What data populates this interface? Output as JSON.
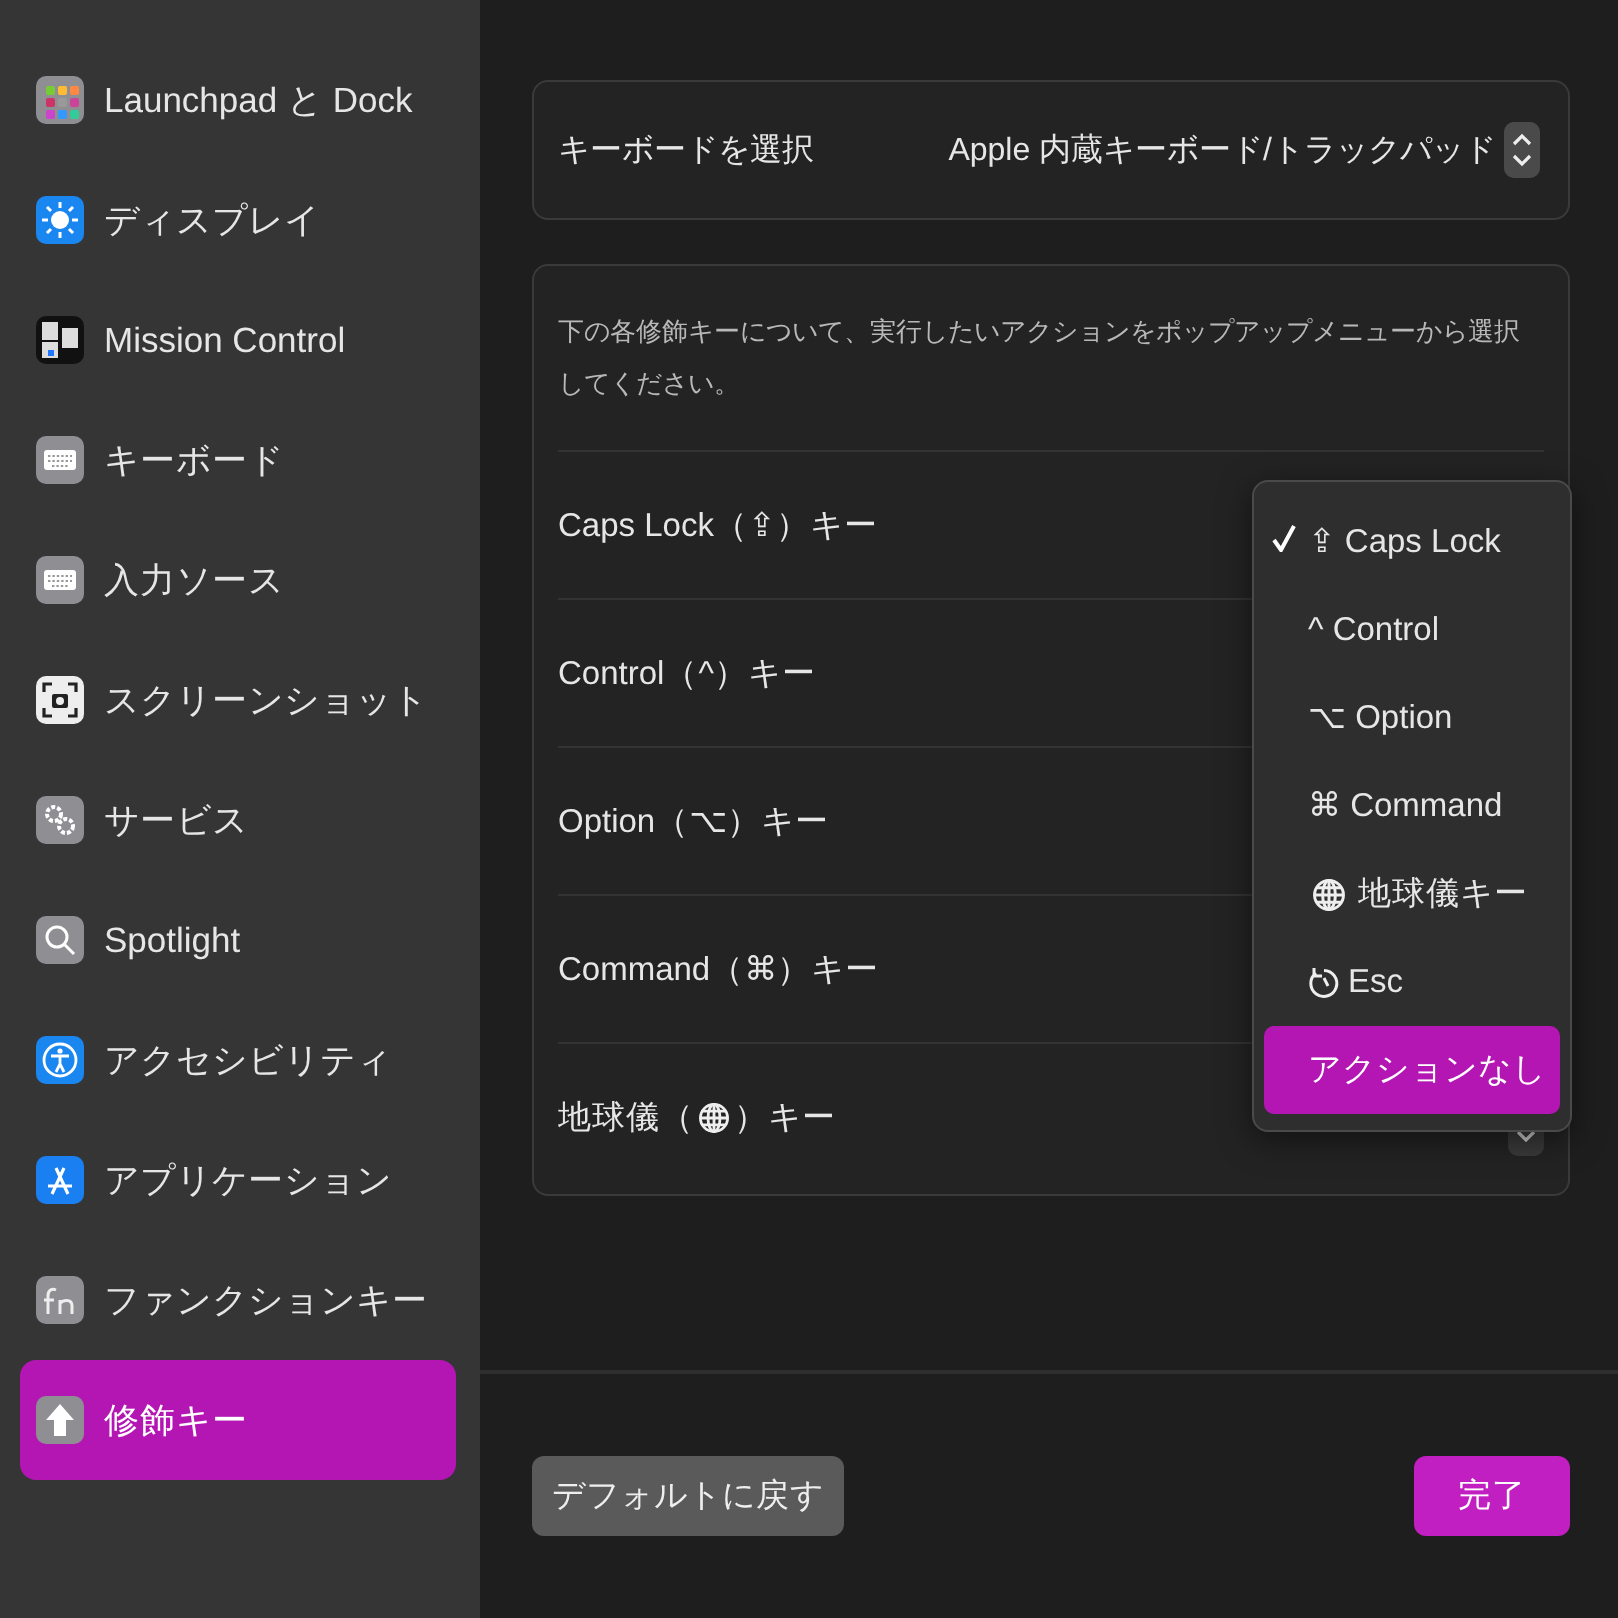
{
  "sidebar": {
    "items": [
      {
        "label": "Launchpad と Dock",
        "kind": "launchpad",
        "selected": false
      },
      {
        "label": "ディスプレイ",
        "kind": "display",
        "selected": false
      },
      {
        "label": "Mission Control",
        "kind": "mission",
        "selected": false
      },
      {
        "label": "キーボード",
        "kind": "keyboard",
        "selected": false
      },
      {
        "label": "入力ソース",
        "kind": "keyboard",
        "selected": false
      },
      {
        "label": "スクリーンショット",
        "kind": "screenshot",
        "selected": false
      },
      {
        "label": "サービス",
        "kind": "gears",
        "selected": false
      },
      {
        "label": "Spotlight",
        "kind": "search",
        "selected": false
      },
      {
        "label": "アクセシビリティ",
        "kind": "accessibility",
        "selected": false
      },
      {
        "label": "アプリケーション",
        "kind": "appstore",
        "selected": false
      },
      {
        "label": "ファンクションキー",
        "kind": "fn",
        "selected": false
      },
      {
        "label": "修飾キー",
        "kind": "arrow",
        "selected": true
      }
    ]
  },
  "keyboard_select": {
    "label": "キーボードを選択",
    "value": "Apple 内蔵キーボード/トラックパッド"
  },
  "description": "下の各修飾キーについて、実行したいアクションをポップアップメニューから選択してください。",
  "modifier_rows": [
    {
      "label": "Caps Lock（⇪）キー"
    },
    {
      "label": "Control（^）キー"
    },
    {
      "label": "Option（⌥）キー"
    },
    {
      "label": "Command（⌘）キー"
    },
    {
      "label": "地球儀（",
      "suffix": "）キー",
      "kind": "globe"
    }
  ],
  "popup_menu": {
    "items": [
      {
        "label": "⇪ Caps Lock",
        "kind": "text",
        "checked": true,
        "selected": false
      },
      {
        "label": "^ Control",
        "kind": "text",
        "checked": false,
        "selected": false
      },
      {
        "label": "⌥ Option",
        "kind": "text",
        "checked": false,
        "selected": false
      },
      {
        "label": "⌘ Command",
        "kind": "text",
        "checked": false,
        "selected": false
      },
      {
        "label": "地球儀キー",
        "kind": "globe",
        "checked": false,
        "selected": false
      },
      {
        "label": "Esc",
        "kind": "escape",
        "checked": false,
        "selected": false
      },
      {
        "label": "アクションなし",
        "kind": "text",
        "checked": false,
        "selected": true
      }
    ]
  },
  "buttons": [
    {
      "label": "デフォルトに戻す",
      "kind": "secondary"
    },
    {
      "label": "完了",
      "kind": "primary"
    }
  ]
}
